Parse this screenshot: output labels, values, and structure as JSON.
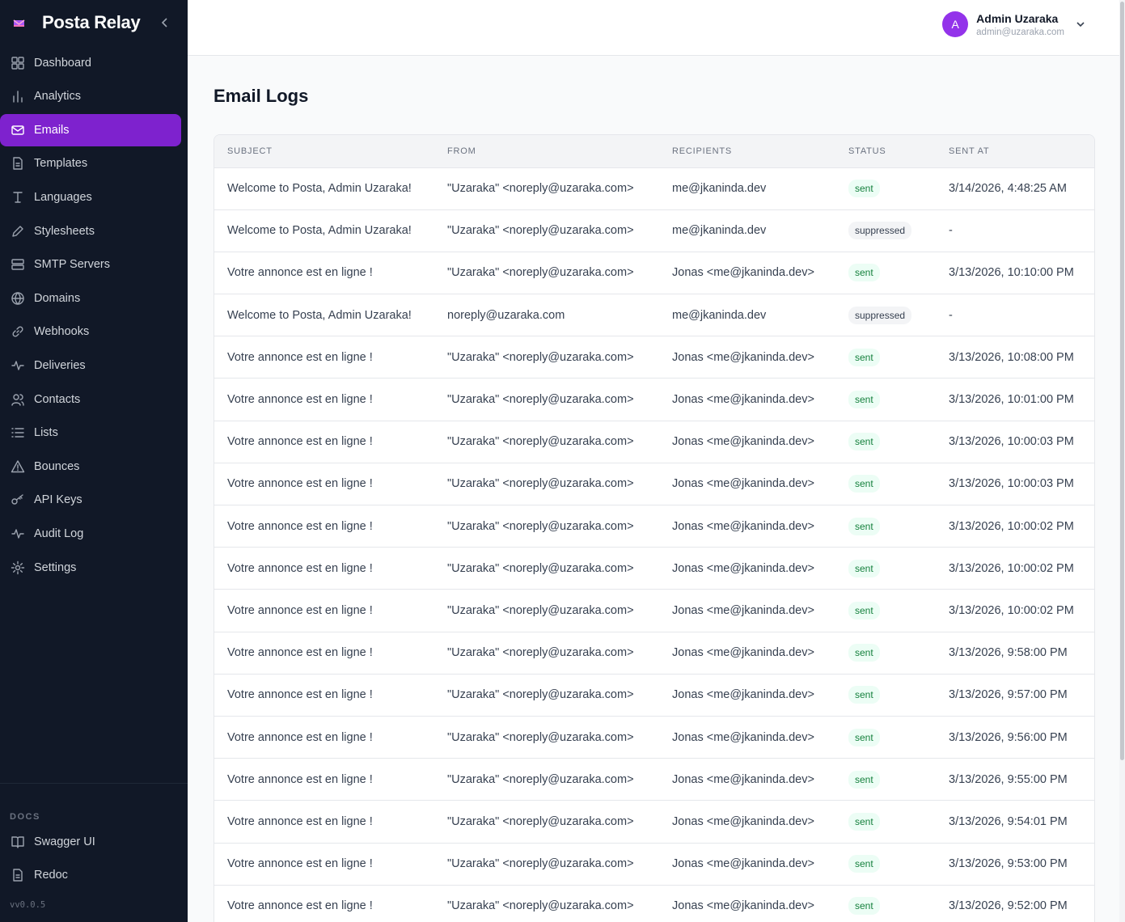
{
  "app": {
    "name": "Posta Relay",
    "version": "vv0.0.5"
  },
  "colors": {
    "accent": "#7e22ce",
    "sidebar_bg": "#111827",
    "sent": "#15803d"
  },
  "sidebar": {
    "items": [
      {
        "label": "Dashboard",
        "icon": "grid-icon"
      },
      {
        "label": "Analytics",
        "icon": "bar-chart-icon"
      },
      {
        "label": "Emails",
        "icon": "mail-icon",
        "active": true
      },
      {
        "label": "Templates",
        "icon": "file-icon"
      },
      {
        "label": "Languages",
        "icon": "text-icon"
      },
      {
        "label": "Stylesheets",
        "icon": "pen-icon"
      },
      {
        "label": "SMTP Servers",
        "icon": "server-icon"
      },
      {
        "label": "Domains",
        "icon": "globe-icon"
      },
      {
        "label": "Webhooks",
        "icon": "link-icon"
      },
      {
        "label": "Deliveries",
        "icon": "activity-icon"
      },
      {
        "label": "Contacts",
        "icon": "users-icon"
      },
      {
        "label": "Lists",
        "icon": "list-icon"
      },
      {
        "label": "Bounces",
        "icon": "alert-triangle-icon"
      },
      {
        "label": "API Keys",
        "icon": "key-icon"
      },
      {
        "label": "Audit Log",
        "icon": "activity-icon"
      },
      {
        "label": "Settings",
        "icon": "gear-icon"
      }
    ],
    "docs_label": "DOCS",
    "docs_items": [
      {
        "label": "Swagger UI",
        "icon": "book-icon"
      },
      {
        "label": "Redoc",
        "icon": "file-icon"
      }
    ]
  },
  "header": {
    "user": {
      "initial": "A",
      "name": "Admin Uzaraka",
      "email": "admin@uzaraka.com"
    }
  },
  "main": {
    "title": "Email Logs",
    "columns": [
      "Subject",
      "From",
      "Recipients",
      "Status",
      "Sent At"
    ],
    "rows": [
      {
        "subject": "Welcome to Posta, Admin Uzaraka!",
        "from": "\"Uzaraka\" <noreply@uzaraka.com>",
        "recipients": "me@jkaninda.dev",
        "status": "sent",
        "sent_at": "3/14/2026, 4:48:25 AM"
      },
      {
        "subject": "Welcome to Posta, Admin Uzaraka!",
        "from": "\"Uzaraka\" <noreply@uzaraka.com>",
        "recipients": "me@jkaninda.dev",
        "status": "suppressed",
        "sent_at": "-"
      },
      {
        "subject": "Votre annonce est en ligne !",
        "from": "\"Uzaraka\" <noreply@uzaraka.com>",
        "recipients": "Jonas <me@jkaninda.dev>",
        "status": "sent",
        "sent_at": "3/13/2026, 10:10:00 PM"
      },
      {
        "subject": "Welcome to Posta, Admin Uzaraka!",
        "from": "noreply@uzaraka.com",
        "recipients": "me@jkaninda.dev",
        "status": "suppressed",
        "sent_at": "-"
      },
      {
        "subject": "Votre annonce est en ligne !",
        "from": "\"Uzaraka\" <noreply@uzaraka.com>",
        "recipients": "Jonas <me@jkaninda.dev>",
        "status": "sent",
        "sent_at": "3/13/2026, 10:08:00 PM"
      },
      {
        "subject": "Votre annonce est en ligne !",
        "from": "\"Uzaraka\" <noreply@uzaraka.com>",
        "recipients": "Jonas <me@jkaninda.dev>",
        "status": "sent",
        "sent_at": "3/13/2026, 10:01:00 PM"
      },
      {
        "subject": "Votre annonce est en ligne !",
        "from": "\"Uzaraka\" <noreply@uzaraka.com>",
        "recipients": "Jonas <me@jkaninda.dev>",
        "status": "sent",
        "sent_at": "3/13/2026, 10:00:03 PM"
      },
      {
        "subject": "Votre annonce est en ligne !",
        "from": "\"Uzaraka\" <noreply@uzaraka.com>",
        "recipients": "Jonas <me@jkaninda.dev>",
        "status": "sent",
        "sent_at": "3/13/2026, 10:00:03 PM"
      },
      {
        "subject": "Votre annonce est en ligne !",
        "from": "\"Uzaraka\" <noreply@uzaraka.com>",
        "recipients": "Jonas <me@jkaninda.dev>",
        "status": "sent",
        "sent_at": "3/13/2026, 10:00:02 PM"
      },
      {
        "subject": "Votre annonce est en ligne !",
        "from": "\"Uzaraka\" <noreply@uzaraka.com>",
        "recipients": "Jonas <me@jkaninda.dev>",
        "status": "sent",
        "sent_at": "3/13/2026, 10:00:02 PM"
      },
      {
        "subject": "Votre annonce est en ligne !",
        "from": "\"Uzaraka\" <noreply@uzaraka.com>",
        "recipients": "Jonas <me@jkaninda.dev>",
        "status": "sent",
        "sent_at": "3/13/2026, 10:00:02 PM"
      },
      {
        "subject": "Votre annonce est en ligne !",
        "from": "\"Uzaraka\" <noreply@uzaraka.com>",
        "recipients": "Jonas <me@jkaninda.dev>",
        "status": "sent",
        "sent_at": "3/13/2026, 9:58:00 PM"
      },
      {
        "subject": "Votre annonce est en ligne !",
        "from": "\"Uzaraka\" <noreply@uzaraka.com>",
        "recipients": "Jonas <me@jkaninda.dev>",
        "status": "sent",
        "sent_at": "3/13/2026, 9:57:00 PM"
      },
      {
        "subject": "Votre annonce est en ligne !",
        "from": "\"Uzaraka\" <noreply@uzaraka.com>",
        "recipients": "Jonas <me@jkaninda.dev>",
        "status": "sent",
        "sent_at": "3/13/2026, 9:56:00 PM"
      },
      {
        "subject": "Votre annonce est en ligne !",
        "from": "\"Uzaraka\" <noreply@uzaraka.com>",
        "recipients": "Jonas <me@jkaninda.dev>",
        "status": "sent",
        "sent_at": "3/13/2026, 9:55:00 PM"
      },
      {
        "subject": "Votre annonce est en ligne !",
        "from": "\"Uzaraka\" <noreply@uzaraka.com>",
        "recipients": "Jonas <me@jkaninda.dev>",
        "status": "sent",
        "sent_at": "3/13/2026, 9:54:01 PM"
      },
      {
        "subject": "Votre annonce est en ligne !",
        "from": "\"Uzaraka\" <noreply@uzaraka.com>",
        "recipients": "Jonas <me@jkaninda.dev>",
        "status": "sent",
        "sent_at": "3/13/2026, 9:53:00 PM"
      },
      {
        "subject": "Votre annonce est en ligne !",
        "from": "\"Uzaraka\" <noreply@uzaraka.com>",
        "recipients": "Jonas <me@jkaninda.dev>",
        "status": "sent",
        "sent_at": "3/13/2026, 9:52:00 PM"
      }
    ]
  }
}
